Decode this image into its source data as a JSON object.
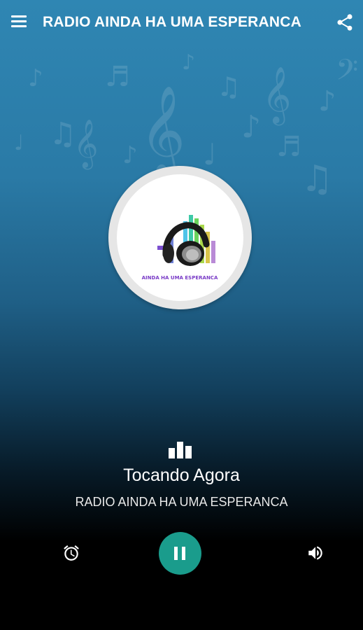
{
  "appbar": {
    "title": "RADIO AINDA HA UMA ESPERANCA",
    "menu_icon": "hamburger-menu-icon",
    "share_icon": "share-icon"
  },
  "logo": {
    "image": "radio-station-logo-headphones-equalizer",
    "caption": "AINDA HA UMA ESPERANCA"
  },
  "player": {
    "status_icon": "equalizer-icon",
    "status_label": "Tocando Agora",
    "station_name": "RADIO AINDA HA UMA ESPERANCA",
    "controls": {
      "alarm_icon": "alarm-clock-icon",
      "play_pause_icon": "pause-icon",
      "volume_icon": "volume-up-icon"
    }
  },
  "colors": {
    "background_top": "#2f86b3",
    "background_bottom": "#000000",
    "accent": "#1a9c8c"
  }
}
